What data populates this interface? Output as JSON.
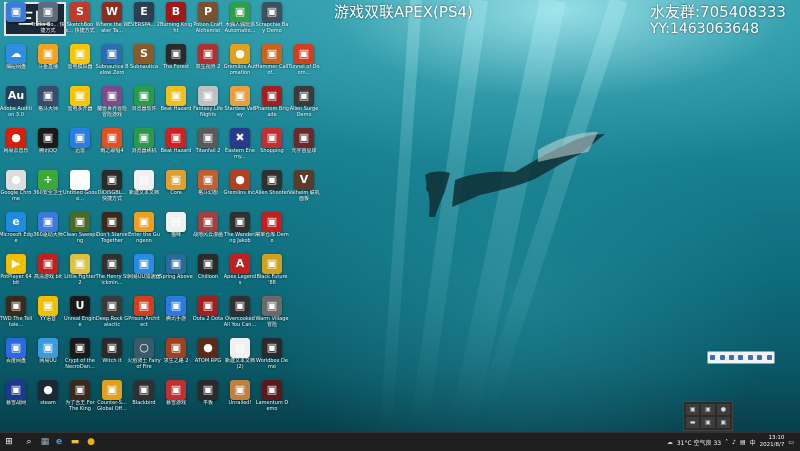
{
  "overlay": {
    "logo_text": "三国",
    "game_title": "游戏双联APEX(PS4)",
    "fan_group": "水友群:705408333",
    "yy_number": "YY:1463063648"
  },
  "desktop_icons": [
    {
      "label": "",
      "color": "#3a7bd5",
      "glyph": "▣",
      "col": 0,
      "row": 0
    },
    {
      "label": "Tricks Bo... 快捷方式",
      "color": "#5a6b7c",
      "glyph": "▣",
      "col": 1,
      "row": 0
    },
    {
      "label": "SketchBook... 快捷方式",
      "color": "#c0392b",
      "glyph": "S",
      "col": 2,
      "row": 0
    },
    {
      "label": "Where the Water Ta...",
      "color": "#8e2c22",
      "glyph": "W",
      "col": 3,
      "row": 0
    },
    {
      "label": "EVERSPA... 2",
      "color": "#2c3e50",
      "glyph": "E",
      "col": 4,
      "row": 0
    },
    {
      "label": "Burning Knight",
      "color": "#a01818",
      "glyph": "B",
      "col": 5,
      "row": 0
    },
    {
      "label": "Potion Craft Alchemist",
      "color": "#7a5230",
      "glyph": "P",
      "col": 6,
      "row": 0
    },
    {
      "label": "木偶人偶玩派 Automatio...",
      "color": "#2e9e4b",
      "glyph": "▣",
      "col": 7,
      "row": 0
    },
    {
      "label": "Scrapchie Bay Demo",
      "color": "#405060",
      "glyph": "▣",
      "col": 8,
      "row": 0
    },
    {
      "label": "抽屉网盘",
      "color": "#2f8ee0",
      "glyph": "☁",
      "col": 0,
      "row": 1
    },
    {
      "label": "斗鱼直播",
      "color": "#f4a11b",
      "glyph": "▣",
      "col": 1,
      "row": 1
    },
    {
      "label": "雷电模拟器",
      "color": "#f7c600",
      "glyph": "▣",
      "col": 2,
      "row": 1
    },
    {
      "label": "Subnautica Below Zero",
      "color": "#2c6fb0",
      "glyph": "▣",
      "col": 3,
      "row": 1
    },
    {
      "label": "Subnautica",
      "color": "#8a5a2a",
      "glyph": "S",
      "col": 4,
      "row": 1
    },
    {
      "label": "The Forest",
      "color": "#2a2a2a",
      "glyph": "▣",
      "col": 5,
      "row": 1
    },
    {
      "label": "双生视界 2",
      "color": "#b03030",
      "glyph": "▣",
      "col": 6,
      "row": 1
    },
    {
      "label": "Gremlins Automation",
      "color": "#e0a020",
      "glyph": "●",
      "col": 7,
      "row": 1
    },
    {
      "label": "Hammer Call of...",
      "color": "#c8641e",
      "glyph": "▣",
      "col": 8,
      "row": 1
    },
    {
      "label": "Tunnel of Doom...",
      "color": "#d04020",
      "glyph": "▣",
      "col": 9,
      "row": 1
    },
    {
      "label": "Adobe Audition 3.0",
      "color": "#1f3f5a",
      "glyph": "Au",
      "col": 0,
      "row": 2
    },
    {
      "label": "格斗大师",
      "color": "#3a4a6a",
      "glyph": "▣",
      "col": 1,
      "row": 2
    },
    {
      "label": "雷电多开器",
      "color": "#f7c600",
      "glyph": "▣",
      "col": 2,
      "row": 2
    },
    {
      "label": "魔兽世界冒险 冒险游戏",
      "color": "#7a4a8a",
      "glyph": "▣",
      "col": 3,
      "row": 2
    },
    {
      "label": "浏览器软件",
      "color": "#2a9a4a",
      "glyph": "▣",
      "col": 4,
      "row": 2
    },
    {
      "label": "Beat Hazard",
      "color": "#f0c020",
      "glyph": "▣",
      "col": 5,
      "row": 2
    },
    {
      "label": "Fantasy Life Nights",
      "color": "#c0c0c0",
      "glyph": "▣",
      "col": 6,
      "row": 2
    },
    {
      "label": "Stardew Valley",
      "color": "#e8a040",
      "glyph": "▣",
      "col": 7,
      "row": 2
    },
    {
      "label": "Phantom Brigade",
      "color": "#a02020",
      "glyph": "▣",
      "col": 8,
      "row": 2
    },
    {
      "label": "Alien Surge Demo",
      "color": "#3a3a3a",
      "glyph": "▣",
      "col": 9,
      "row": 2
    },
    {
      "label": "网易云音乐",
      "color": "#d81e06",
      "glyph": "●",
      "col": 0,
      "row": 3
    },
    {
      "label": "腾讯QQ",
      "color": "#1a1a1a",
      "glyph": "▣",
      "col": 1,
      "row": 3
    },
    {
      "label": "迅雷",
      "color": "#2a7ee0",
      "glyph": "▣",
      "col": 2,
      "row": 3
    },
    {
      "label": "雨之歌唱4",
      "color": "#e05020",
      "glyph": "▣",
      "col": 3,
      "row": 3
    },
    {
      "label": "浏览器刷机",
      "color": "#2a9a4a",
      "glyph": "▣",
      "col": 4,
      "row": 3
    },
    {
      "label": "Beat Hazard",
      "color": "#d02020",
      "glyph": "▣",
      "col": 5,
      "row": 3
    },
    {
      "label": "Titanfall 2",
      "color": "#5a5a5a",
      "glyph": "▣",
      "col": 6,
      "row": 3
    },
    {
      "label": "Eastern Enemy...",
      "color": "#2a3a8a",
      "glyph": "✖",
      "col": 7,
      "row": 3
    },
    {
      "label": "Shopping",
      "color": "#c03030",
      "glyph": "▣",
      "col": 8,
      "row": 3
    },
    {
      "label": "元宇宙星球",
      "color": "#6a2a2a",
      "glyph": "▣",
      "col": 9,
      "row": 3
    },
    {
      "label": "Google Chrome",
      "color": "#dddddd",
      "glyph": "●",
      "col": 0,
      "row": 4
    },
    {
      "label": "360安全卫士",
      "color": "#3aa83a",
      "glyph": "+",
      "col": 1,
      "row": 4
    },
    {
      "label": "Untitled Goose...",
      "color": "#ffffff",
      "glyph": "△",
      "col": 2,
      "row": 4
    },
    {
      "label": "DiDiSGBL... 快捷方式",
      "color": "#2a2a2a",
      "glyph": "▣",
      "col": 3,
      "row": 4
    },
    {
      "label": "新建文本文档",
      "color": "#f0f0f0",
      "glyph": "▤",
      "col": 4,
      "row": 4
    },
    {
      "label": "Core",
      "color": "#e0a030",
      "glyph": "▣",
      "col": 5,
      "row": 4
    },
    {
      "label": "格斗幻想",
      "color": "#c06030",
      "glyph": "▣",
      "col": 6,
      "row": 4
    },
    {
      "label": "Gremlins Inc.",
      "color": "#b04020",
      "glyph": "●",
      "col": 7,
      "row": 4
    },
    {
      "label": "Alien Shooter",
      "color": "#303030",
      "glyph": "▣",
      "col": 8,
      "row": 4
    },
    {
      "label": "Valheim 联机面板",
      "color": "#5a3a2a",
      "glyph": "V",
      "col": 9,
      "row": 4
    },
    {
      "label": "Microsoft Edge",
      "color": "#1e8ae0",
      "glyph": "e",
      "col": 0,
      "row": 5
    },
    {
      "label": "360驱动大师",
      "color": "#3a7ae0",
      "glyph": "▣",
      "col": 1,
      "row": 5
    },
    {
      "label": "Clean Sweeping",
      "color": "#4a6a2a",
      "glyph": "▣",
      "col": 2,
      "row": 5
    },
    {
      "label": "Don't Starve Together",
      "color": "#3a2a1a",
      "glyph": "▣",
      "col": 3,
      "row": 5
    },
    {
      "label": "Enter the Gungeon",
      "color": "#f0a020",
      "glyph": "▣",
      "col": 4,
      "row": 5
    },
    {
      "label": "猫咪",
      "color": "#f0f0f0",
      "glyph": "▤",
      "col": 5,
      "row": 5
    },
    {
      "label": "战地风云漫画",
      "color": "#a04040",
      "glyph": "▣",
      "col": 6,
      "row": 5
    },
    {
      "label": "The Wandering Jakob",
      "color": "#303030",
      "glyph": "▣",
      "col": 7,
      "row": 5
    },
    {
      "label": "屠宰仓库 Demo",
      "color": "#c02020",
      "glyph": "▣",
      "col": 8,
      "row": 5
    },
    {
      "label": "PotPlayer 64 bit",
      "color": "#f0c000",
      "glyph": "▶",
      "col": 0,
      "row": 6
    },
    {
      "label": "高清游戏 bit",
      "color": "#c02020",
      "glyph": "▣",
      "col": 1,
      "row": 6
    },
    {
      "label": "Little Fighter 2",
      "color": "#e0c040",
      "glyph": "▣",
      "col": 2,
      "row": 6
    },
    {
      "label": "The Henry Stickmin...",
      "color": "#303030",
      "glyph": "▣",
      "col": 3,
      "row": 6
    },
    {
      "label": "网易UU加速器",
      "color": "#2a8ae0",
      "glyph": "▣",
      "col": 4,
      "row": 6
    },
    {
      "label": "Spring Above",
      "color": "#2a6a9a",
      "glyph": "▣",
      "col": 5,
      "row": 6
    },
    {
      "label": "Chilloon",
      "color": "#2a2a2a",
      "glyph": "▣",
      "col": 6,
      "row": 6
    },
    {
      "label": "Apex Legends",
      "color": "#c02020",
      "glyph": "A",
      "col": 7,
      "row": 6
    },
    {
      "label": "Black Future '88",
      "color": "#d0a020",
      "glyph": "▣",
      "col": 8,
      "row": 6
    },
    {
      "label": "TWD The Telltale...",
      "color": "#3a2a1a",
      "glyph": "▣",
      "col": 0,
      "row": 7
    },
    {
      "label": "YY语音",
      "color": "#f0c000",
      "glyph": "▣",
      "col": 1,
      "row": 7
    },
    {
      "label": "Unreal Engine",
      "color": "#1a1a1a",
      "glyph": "U",
      "col": 2,
      "row": 7
    },
    {
      "label": "Deep Rock Galactic",
      "color": "#3a3a3a",
      "glyph": "▣",
      "col": 3,
      "row": 7
    },
    {
      "label": "Prison Architect",
      "color": "#d04020",
      "glyph": "▣",
      "col": 4,
      "row": 7
    },
    {
      "label": "腾讯手游",
      "color": "#2a7ae0",
      "glyph": "▣",
      "col": 5,
      "row": 7
    },
    {
      "label": "Dota 2 Dota",
      "color": "#a02020",
      "glyph": "▣",
      "col": 6,
      "row": 7
    },
    {
      "label": "Overcooked All You Can...",
      "color": "#303030",
      "glyph": "▣",
      "col": 7,
      "row": 7
    },
    {
      "label": "Warm Village 冒险",
      "color": "#6a6a6a",
      "glyph": "▣",
      "col": 8,
      "row": 7
    },
    {
      "label": "百度网盘",
      "color": "#2a6ae0",
      "glyph": "▣",
      "col": 0,
      "row": 8
    },
    {
      "label": "网易UU",
      "color": "#3a9ae0",
      "glyph": "▣",
      "col": 1,
      "row": 8
    },
    {
      "label": "Crypt of the NecroDan...",
      "color": "#1a1a1a",
      "glyph": "▣",
      "col": 2,
      "row": 8
    },
    {
      "label": "Witch It",
      "color": "#2a2a2a",
      "glyph": "▣",
      "col": 3,
      "row": 8
    },
    {
      "label": "火焰骑士 Fairy of Fire",
      "color": "#3a5a6a",
      "glyph": "○",
      "col": 4,
      "row": 8
    },
    {
      "label": "求生之路 2",
      "color": "#a04020",
      "glyph": "▣",
      "col": 5,
      "row": 8
    },
    {
      "label": "ATOM RPG",
      "color": "#5a2a1a",
      "glyph": "●",
      "col": 6,
      "row": 8
    },
    {
      "label": "新建文本文档 (2)",
      "color": "#f0f0f0",
      "glyph": "▤",
      "col": 7,
      "row": 8
    },
    {
      "label": "Worldbox Demo",
      "color": "#2a2a2a",
      "glyph": "▣",
      "col": 8,
      "row": 8
    },
    {
      "label": "暴雪战网",
      "color": "#1a3a8a",
      "glyph": "▣",
      "col": 0,
      "row": 9
    },
    {
      "label": "steam",
      "color": "#1b2838",
      "glyph": "●",
      "col": 1,
      "row": 9
    },
    {
      "label": "为了吾王 For The King",
      "color": "#3a2a1a",
      "glyph": "▣",
      "col": 2,
      "row": 9
    },
    {
      "label": "Counter-S... Global Off...",
      "color": "#e0a020",
      "glyph": "▣",
      "col": 3,
      "row": 9
    },
    {
      "label": "Blackbird",
      "color": "#303030",
      "glyph": "▣",
      "col": 4,
      "row": 9
    },
    {
      "label": "暴雪游戏",
      "color": "#c03030",
      "glyph": "▣",
      "col": 5,
      "row": 9
    },
    {
      "label": "平板",
      "color": "#2a2a2a",
      "glyph": "▣",
      "col": 6,
      "row": 9
    },
    {
      "label": "Unrailed!",
      "color": "#c08040",
      "glyph": "▣",
      "col": 7,
      "row": 9
    },
    {
      "label": "Lamentum Demo",
      "color": "#5a1a1a",
      "glyph": "▣",
      "col": 8,
      "row": 9
    }
  ],
  "taskbar": {
    "start_glyph": "⊞",
    "search_glyph": "⌕",
    "task_view_glyph": "▦",
    "edge_glyph": "e",
    "explorer_glyph": "▬",
    "chrome_glyph": "●",
    "weather": "31°C 空气良 33",
    "time": "13:10",
    "date": "2021/8/7"
  },
  "tray_flyout": [
    "▣",
    "▣",
    "●",
    "▬",
    "▣",
    "▣"
  ]
}
